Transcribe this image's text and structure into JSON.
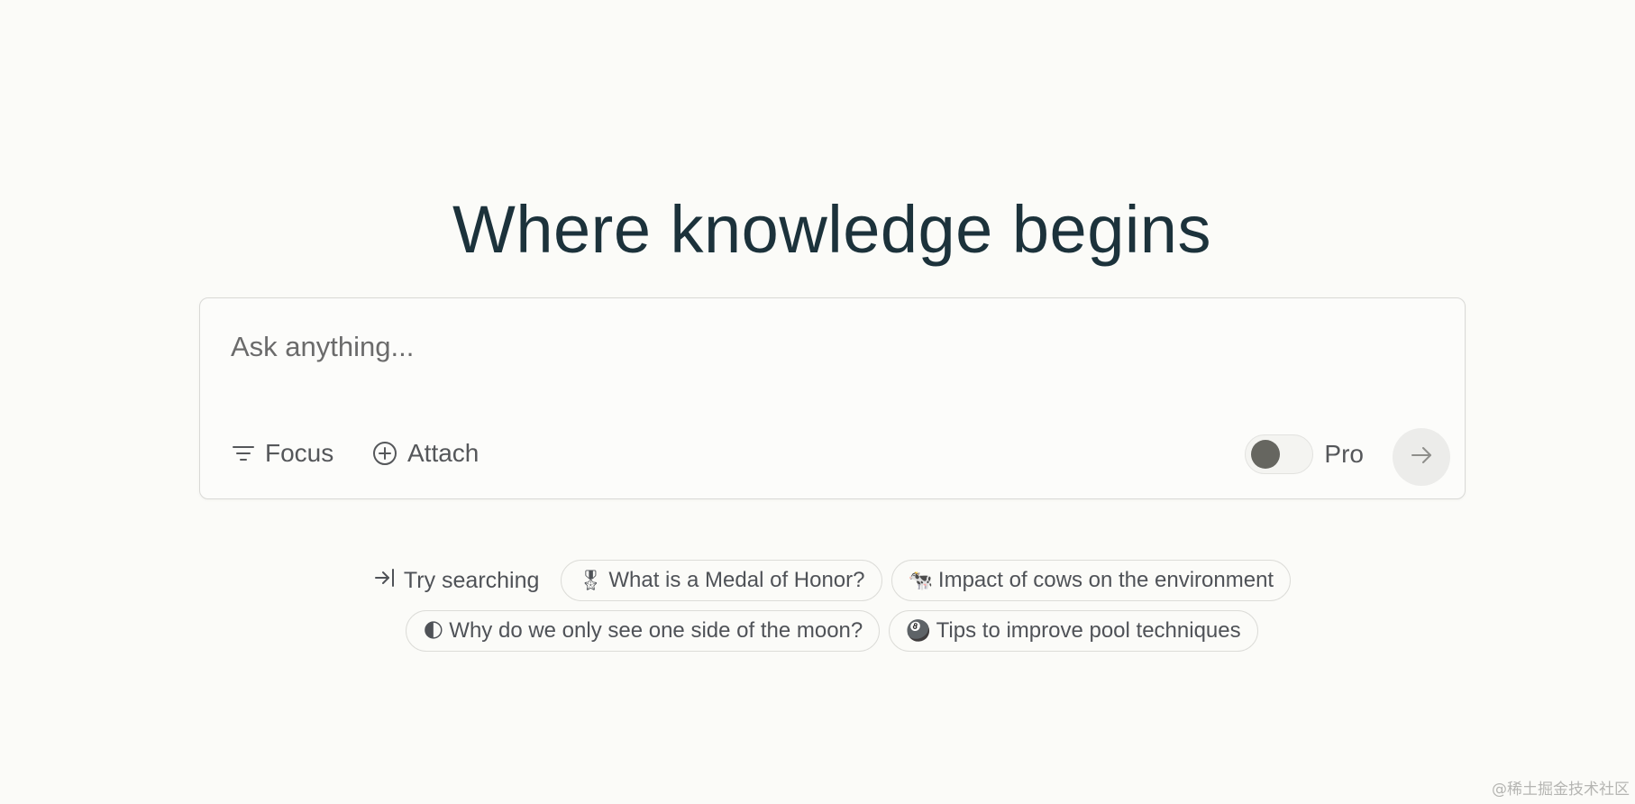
{
  "headline": "Where knowledge begins",
  "search": {
    "placeholder": "Ask anything..."
  },
  "toolbar": {
    "focus_label": "Focus",
    "attach_label": "Attach",
    "pro_label": "Pro",
    "pro_enabled": false
  },
  "suggestions": {
    "try_label": "Try searching",
    "items": [
      {
        "emoji": "🎖",
        "label": "What is a Medal of Honor?"
      },
      {
        "emoji": "🐄",
        "label": "Impact of cows on the environment"
      },
      {
        "emoji": "🌓",
        "label": "Why do we only see one side of the moon?"
      },
      {
        "emoji": "🎱",
        "label": "Tips to improve pool techniques"
      }
    ]
  },
  "watermark": "@稀土掘金技术社区",
  "colors": {
    "background": "#fbfbf8",
    "headline": "#1c323b",
    "toggle_knob": "#666660",
    "submit_bg": "#ececea"
  },
  "icons": {
    "focus": "filter-lines-icon",
    "attach": "plus-circle-icon",
    "submit": "arrow-right-icon",
    "try": "arrow-into-icon"
  }
}
